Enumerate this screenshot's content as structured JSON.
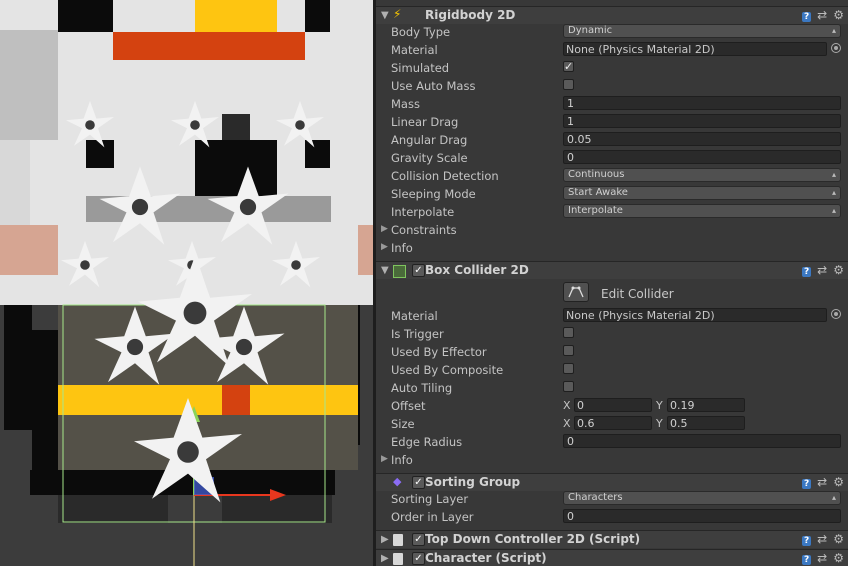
{
  "scene": {
    "colors": {
      "light": "#e4e4e4",
      "black": "#0b0b0b",
      "yellow": "#fec511",
      "orange": "#d44210",
      "gray": "#bfbfbf",
      "dark": "#3c3c3c",
      "brown": "#545148",
      "skin": "#d6a592",
      "shuriken": "#f2f2f2",
      "gizmo_box": "#a6e68a",
      "axis_x": "#e8371e",
      "axis_y": "#8ad35a",
      "axis_z": "#3e57c6"
    }
  },
  "inspector": {
    "rigidbody": {
      "title": "Rigidbody 2D",
      "icon": "rigidbody-icon",
      "props": [
        {
          "label": "Body Type",
          "type": "dropdown",
          "value": "Dynamic"
        },
        {
          "label": "Material",
          "type": "object",
          "value": "None (Physics Material 2D)"
        },
        {
          "label": "Simulated",
          "type": "toggle",
          "checked": true
        },
        {
          "label": "Use Auto Mass",
          "type": "toggle",
          "checked": false
        },
        {
          "label": "Mass",
          "type": "field",
          "value": "1"
        },
        {
          "label": "Linear Drag",
          "type": "field",
          "value": "1"
        },
        {
          "label": "Angular Drag",
          "type": "field",
          "value": "0.05"
        },
        {
          "label": "Gravity Scale",
          "type": "field",
          "value": "0"
        },
        {
          "label": "Collision Detection",
          "type": "dropdown",
          "value": "Continuous"
        },
        {
          "label": "Sleeping Mode",
          "type": "dropdown",
          "value": "Start Awake"
        },
        {
          "label": "Interpolate",
          "type": "dropdown",
          "value": "Interpolate"
        },
        {
          "label": "Constraints",
          "type": "foldout"
        },
        {
          "label": "Info",
          "type": "foldout"
        }
      ]
    },
    "box_collider": {
      "title": "Box Collider 2D",
      "enabled": true,
      "edit_collider": "Edit Collider",
      "props": [
        {
          "label": "Material",
          "type": "object",
          "value": "None (Physics Material 2D)"
        },
        {
          "label": "Is Trigger",
          "type": "toggle",
          "checked": false
        },
        {
          "label": "Used By Effector",
          "type": "toggle",
          "checked": false
        },
        {
          "label": "Used By Composite",
          "type": "toggle",
          "checked": false
        },
        {
          "label": "Auto Tiling",
          "type": "toggle",
          "checked": false
        },
        {
          "label": "Offset",
          "type": "vector2",
          "x": "0",
          "y": "0.19"
        },
        {
          "label": "Size",
          "type": "vector2",
          "x": "0.6",
          "y": "0.5"
        },
        {
          "label": "Edge Radius",
          "type": "field",
          "value": "0"
        },
        {
          "label": "Info",
          "type": "foldout"
        }
      ]
    },
    "sorting_group": {
      "title": "Sorting Group",
      "enabled": true,
      "props": [
        {
          "label": "Sorting Layer",
          "type": "dropdown",
          "value": "Characters"
        },
        {
          "label": "Order in Layer",
          "type": "field",
          "value": "0"
        }
      ]
    },
    "top_down": {
      "title": "Top Down Controller 2D (Script)",
      "enabled": true
    },
    "character": {
      "title": "Character (Script)",
      "enabled": true
    },
    "vec_x_label": "X",
    "vec_y_label": "Y",
    "tool_icons": [
      "help-icon",
      "preset-icon",
      "settings-icon"
    ]
  }
}
